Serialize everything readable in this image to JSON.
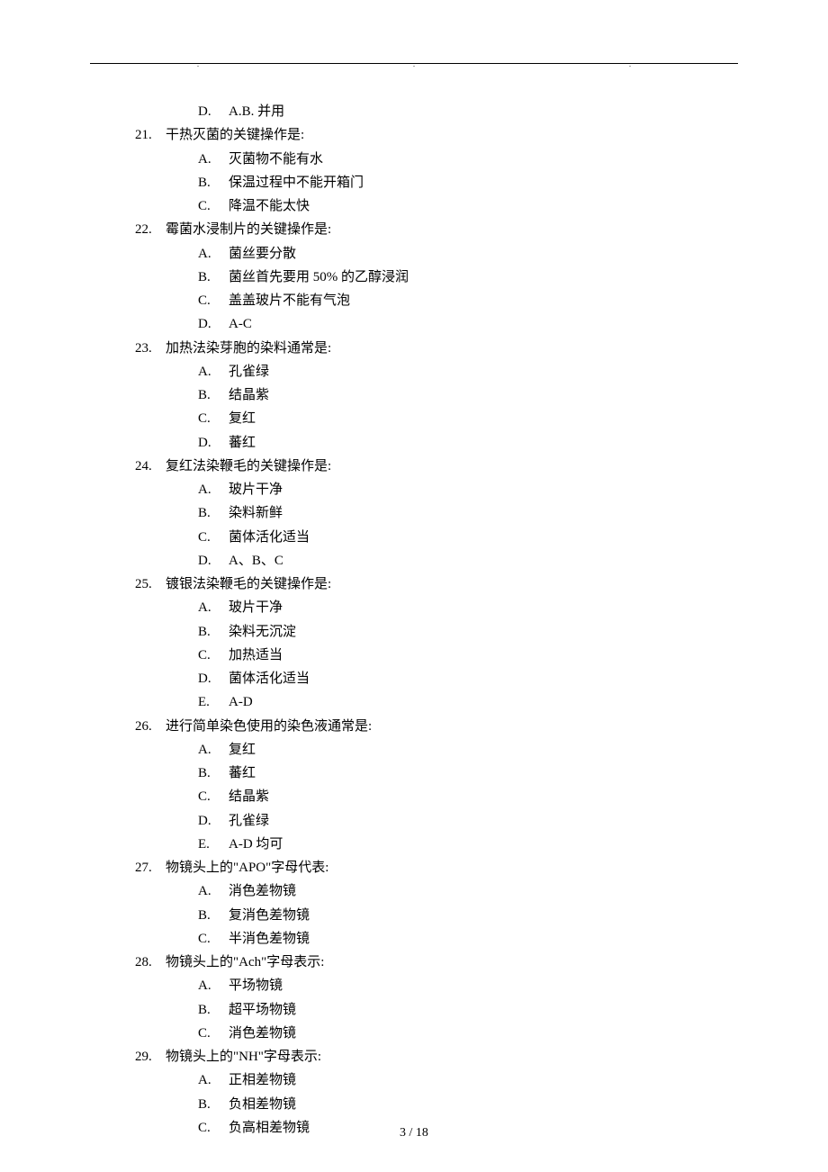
{
  "footer": "3  /  18",
  "questions": [
    {
      "number": "",
      "stem": "",
      "options": [
        {
          "letter": "D.",
          "text": "A.B. 并用"
        }
      ]
    },
    {
      "number": "21.",
      "stem": "干热灭菌的关键操作是:",
      "options": [
        {
          "letter": "A.",
          "text": "灭菌物不能有水"
        },
        {
          "letter": "B.",
          "text": "保温过程中不能开箱门"
        },
        {
          "letter": "C.",
          "text": "降温不能太快"
        }
      ]
    },
    {
      "number": "22.",
      "stem": "霉菌水浸制片的关键操作是:",
      "options": [
        {
          "letter": "A.",
          "text": "菌丝要分散"
        },
        {
          "letter": "B.",
          "text": "菌丝首先要用 50% 的乙醇浸润"
        },
        {
          "letter": "C.",
          "text": "盖盖玻片不能有气泡"
        },
        {
          "letter": "D.",
          "text": "A-C"
        }
      ]
    },
    {
      "number": "23.",
      "stem": "加热法染芽胞的染料通常是:",
      "options": [
        {
          "letter": "A.",
          "text": "孔雀绿"
        },
        {
          "letter": "B.",
          "text": "结晶紫"
        },
        {
          "letter": "C.",
          "text": "复红"
        },
        {
          "letter": "D.",
          "text": "蕃红"
        }
      ]
    },
    {
      "number": "24.",
      "stem": "复红法染鞭毛的关键操作是:",
      "options": [
        {
          "letter": "A.",
          "text": "玻片干净"
        },
        {
          "letter": "B.",
          "text": "染料新鲜"
        },
        {
          "letter": "C.",
          "text": "菌体活化适当"
        },
        {
          "letter": "D.",
          "text": " A、B、C"
        }
      ]
    },
    {
      "number": "25.",
      "stem": "镀银法染鞭毛的关键操作是:",
      "options": [
        {
          "letter": "A.",
          "text": "玻片干净"
        },
        {
          "letter": "B.",
          "text": "染料无沉淀"
        },
        {
          "letter": "C.",
          "text": "加热适当"
        },
        {
          "letter": "D.",
          "text": "菌体活化适当"
        },
        {
          "letter": "E.",
          "text": " A-D"
        }
      ]
    },
    {
      "number": "26.",
      "stem": "进行简单染色使用的染色液通常是:",
      "options": [
        {
          "letter": "A.",
          "text": "复红"
        },
        {
          "letter": "B.",
          "text": "蕃红"
        },
        {
          "letter": "C.",
          "text": "结晶紫"
        },
        {
          "letter": "D.",
          "text": "孔雀绿"
        },
        {
          "letter": "E.",
          "text": " A-D 均可"
        }
      ]
    },
    {
      "number": "27.",
      "stem": "物镜头上的\"APO\"字母代表:",
      "options": [
        {
          "letter": "A.",
          "text": "消色差物镜"
        },
        {
          "letter": "B.",
          "text": "复消色差物镜"
        },
        {
          "letter": "C.",
          "text": "半消色差物镜"
        }
      ]
    },
    {
      "number": "28.",
      "stem": "物镜头上的\"Ach\"字母表示:",
      "options": [
        {
          "letter": "A.",
          "text": "平场物镜"
        },
        {
          "letter": "B.",
          "text": "超平场物镜"
        },
        {
          "letter": "C.",
          "text": "消色差物镜"
        }
      ]
    },
    {
      "number": "29.",
      "stem": "物镜头上的\"NH\"字母表示:",
      "options": [
        {
          "letter": "A.",
          "text": "正相差物镜"
        },
        {
          "letter": "B.",
          "text": "负相差物镜"
        },
        {
          "letter": "C.",
          "text": "负高相差物镜"
        }
      ]
    }
  ]
}
